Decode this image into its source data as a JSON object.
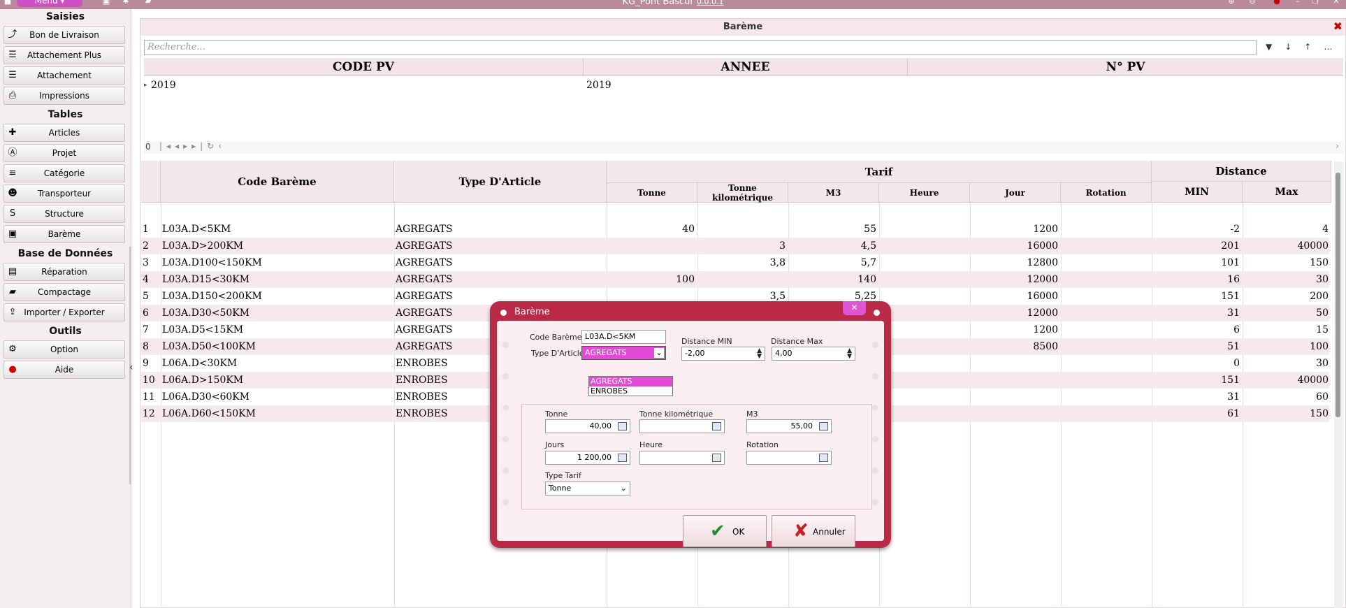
{
  "titlebar": {
    "menu_label": "Menu",
    "title": "KG_Pont Bascul",
    "version": "0.0.0.1"
  },
  "sidebar": {
    "sections": [
      {
        "title": "Saisies",
        "items": [
          {
            "label": "Bon de Livraison",
            "icon": "share-icon"
          },
          {
            "label": "Attachement Plus",
            "icon": "list-icon"
          },
          {
            "label": "Attachement",
            "icon": "list-icon"
          },
          {
            "label": "Impressions",
            "icon": "print-icon"
          }
        ]
      },
      {
        "title": "Tables",
        "items": [
          {
            "label": "Articles",
            "icon": "puzzle-icon"
          },
          {
            "label": "Projet",
            "icon": "road-icon"
          },
          {
            "label": "Catégorie",
            "icon": "list-ol-icon"
          },
          {
            "label": "Transporteur",
            "icon": "users-icon"
          },
          {
            "label": "Structure",
            "icon": "structure-icon"
          },
          {
            "label": "Barème",
            "icon": "money-icon"
          }
        ]
      },
      {
        "title": "Base de Données",
        "items": [
          {
            "label": "Réparation",
            "icon": "toolbox-icon"
          },
          {
            "label": "Compactage",
            "icon": "truck-icon"
          },
          {
            "label": "Importer  / Exporter",
            "icon": "upload-icon"
          }
        ]
      },
      {
        "title": "Outils",
        "items": [
          {
            "label": "Option",
            "icon": "gears-icon"
          },
          {
            "label": "Aide",
            "icon": "help-icon"
          }
        ]
      }
    ]
  },
  "main": {
    "title": "Barème",
    "search_placeholder": "Recherche...",
    "grid1": {
      "headers": [
        "CODE PV",
        "ANNEE",
        "N° PV"
      ],
      "row": {
        "code": "2019",
        "annee": "2019",
        "num": ""
      }
    },
    "pager_count": "0",
    "grid2": {
      "headers": {
        "code": "Code Barème",
        "type": "Type D'Article",
        "tarif": "Tarif",
        "distance": "Distance",
        "tonne": "Tonne",
        "tonne_km": "Tonne kilométrique",
        "m3": "M3",
        "heure": "Heure",
        "jour": "Jour",
        "rotation": "Rotation",
        "min": "MIN",
        "max": "Max"
      },
      "rows": [
        {
          "n": "1",
          "code": "L03A.D<5KM",
          "type": "AGREGATS",
          "tonne": "40",
          "tkm": "",
          "m3": "55",
          "heure": "",
          "jour": "1200",
          "rot": "",
          "min": "-2",
          "max": "4"
        },
        {
          "n": "2",
          "code": "L03A.D>200KM",
          "type": "AGREGATS",
          "tonne": "",
          "tkm": "3",
          "m3": "4,5",
          "heure": "",
          "jour": "16000",
          "rot": "",
          "min": "201",
          "max": "40000"
        },
        {
          "n": "3",
          "code": "L03A.D100<150KM",
          "type": "AGREGATS",
          "tonne": "",
          "tkm": "3,8",
          "m3": "5,7",
          "heure": "",
          "jour": "12800",
          "rot": "",
          "min": "101",
          "max": "150"
        },
        {
          "n": "4",
          "code": "L03A.D15<30KM",
          "type": "AGREGATS",
          "tonne": "100",
          "tkm": "",
          "m3": "140",
          "heure": "",
          "jour": "12000",
          "rot": "",
          "min": "16",
          "max": "30"
        },
        {
          "n": "5",
          "code": "L03A.D150<200KM",
          "type": "AGREGATS",
          "tonne": "",
          "tkm": "3,5",
          "m3": "5,25",
          "heure": "",
          "jour": "16000",
          "rot": "",
          "min": "151",
          "max": "200"
        },
        {
          "n": "6",
          "code": "L03A.D30<50KM",
          "type": "AGREGATS",
          "tonne": "",
          "tkm": "",
          "m3": "",
          "heure": "",
          "jour": "12000",
          "rot": "",
          "min": "31",
          "max": "50"
        },
        {
          "n": "7",
          "code": "L03A.D5<15KM",
          "type": "AGREGATS",
          "tonne": "",
          "tkm": "",
          "m3": "",
          "heure": "",
          "jour": "1200",
          "rot": "",
          "min": "6",
          "max": "15"
        },
        {
          "n": "8",
          "code": "L03A.D50<100KM",
          "type": "AGREGATS",
          "tonne": "",
          "tkm": "",
          "m3": "",
          "heure": "",
          "jour": "8500",
          "rot": "",
          "min": "51",
          "max": "100"
        },
        {
          "n": "9",
          "code": "L06A.D<30KM",
          "type": "ENROBES",
          "tonne": "",
          "tkm": "",
          "m3": "",
          "heure": "",
          "jour": "",
          "rot": "",
          "min": "0",
          "max": "30"
        },
        {
          "n": "10",
          "code": "L06A.D>150KM",
          "type": "ENROBES",
          "tonne": "",
          "tkm": "",
          "m3": "",
          "heure": "",
          "jour": "",
          "rot": "",
          "min": "151",
          "max": "40000"
        },
        {
          "n": "11",
          "code": "L06A.D30<60KM",
          "type": "ENROBES",
          "tonne": "",
          "tkm": "",
          "m3": "",
          "heure": "",
          "jour": "",
          "rot": "",
          "min": "31",
          "max": "60"
        },
        {
          "n": "12",
          "code": "L06A.D60<150KM",
          "type": "ENROBES",
          "tonne": "",
          "tkm": "",
          "m3": "",
          "heure": "",
          "jour": "",
          "rot": "",
          "min": "61",
          "max": "150"
        }
      ]
    }
  },
  "dialog": {
    "title": "Barème",
    "code_label": "Code Barème",
    "code_value": "L03A.D<5KM",
    "type_label": "Type D'Article",
    "type_value": "AGREGATS",
    "type_options": [
      "AGREGATS",
      "ENROBES"
    ],
    "dist_min_label": "Distance  MIN",
    "dist_min_value": "-2,00",
    "dist_max_label": "Distance Max",
    "dist_max_value": "4,00",
    "tonne_label": "Tonne",
    "tonne_value": "40,00",
    "tkm_label": "Tonne kilométrique",
    "tkm_value": "",
    "m3_label": "M3",
    "m3_value": "55,00",
    "jours_label": "Jours",
    "jours_value": "1 200,00",
    "heure_label": "Heure",
    "heure_value": "",
    "rotation_label": "Rotation",
    "rotation_value": "",
    "type_tarif_label": "Type Tarif",
    "type_tarif_value": "Tonne",
    "ok_label": "OK",
    "cancel_label": "Annuler"
  },
  "colors": {
    "accent": "#b92a47",
    "dropdown_select": "#e44ad8",
    "header_bg": "#f4e7ea"
  }
}
